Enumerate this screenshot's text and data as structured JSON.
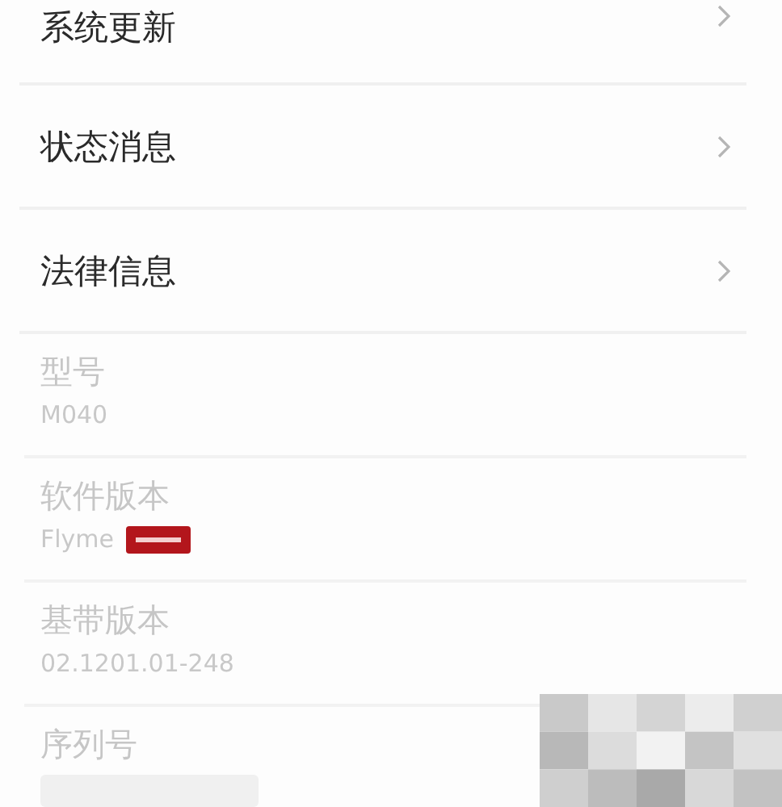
{
  "menu_items": [
    {
      "label": "系统更新"
    },
    {
      "label": "状态消息"
    },
    {
      "label": "法律信息"
    }
  ],
  "info_items": [
    {
      "label": "型号",
      "value": "M040",
      "kind": "text"
    },
    {
      "label": "软件版本",
      "value": "Flyme",
      "kind": "redacted-tag"
    },
    {
      "label": "基带版本",
      "value": "02.1201.01-248",
      "kind": "text"
    },
    {
      "label": "序列号",
      "kind": "blurred"
    }
  ]
}
